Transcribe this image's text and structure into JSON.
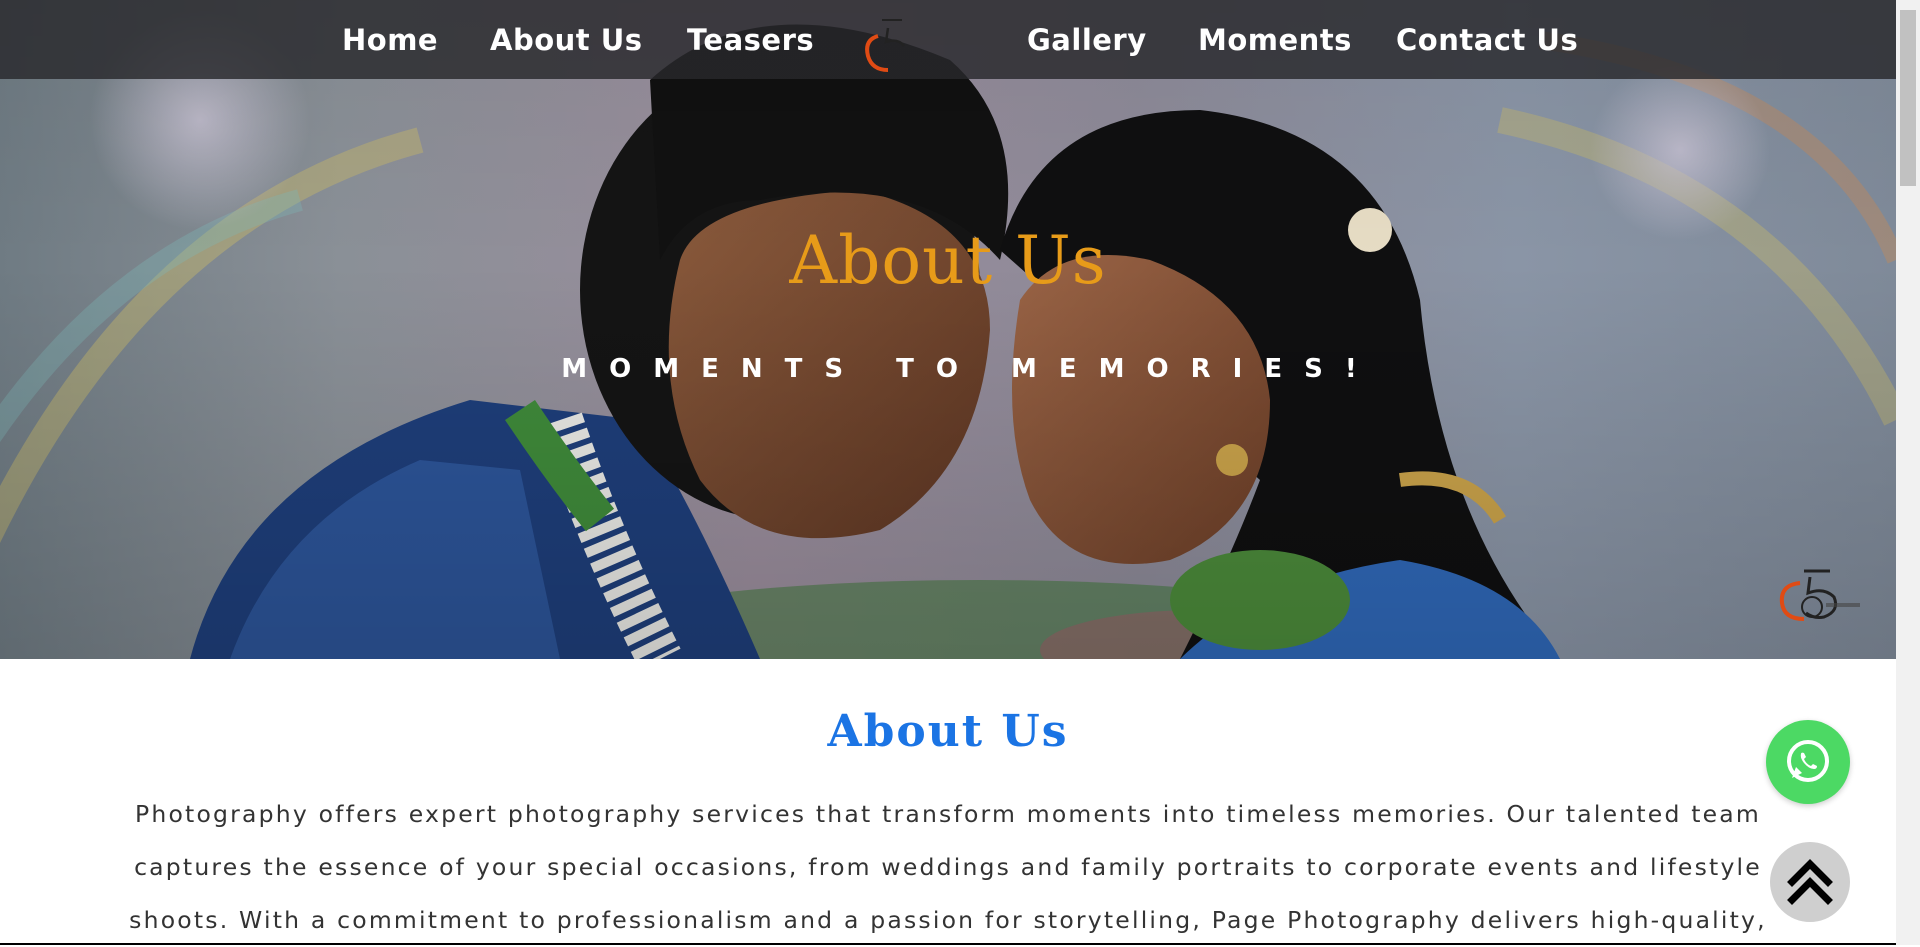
{
  "nav": {
    "items": [
      {
        "label": "Home"
      },
      {
        "label": "About Us"
      },
      {
        "label": "Teasers"
      },
      {
        "label": "Gallery"
      },
      {
        "label": "Moments"
      },
      {
        "label": "Contact Us"
      }
    ]
  },
  "hero": {
    "title": "About Us",
    "subtitle": "MOMENTS TO MEMORIES!"
  },
  "about": {
    "heading": "About Us",
    "paragraph": "Photography offers expert photography services that transform moments into timeless memories. Our talented team captures the essence of your special occasions, from weddings and family portraits to corporate events and lifestyle shoots. With a commitment to professionalism and a passion for storytelling, Page Photography delivers high-quality,"
  },
  "floating": {
    "whatsapp_icon": "whatsapp-icon",
    "scroll_top_icon": "double-chevron-up-icon"
  },
  "colors": {
    "accent_orange": "#e79b19",
    "heading_blue": "#1b74e4",
    "whatsapp_green": "#4cd964",
    "nav_bg": "#28282c"
  }
}
